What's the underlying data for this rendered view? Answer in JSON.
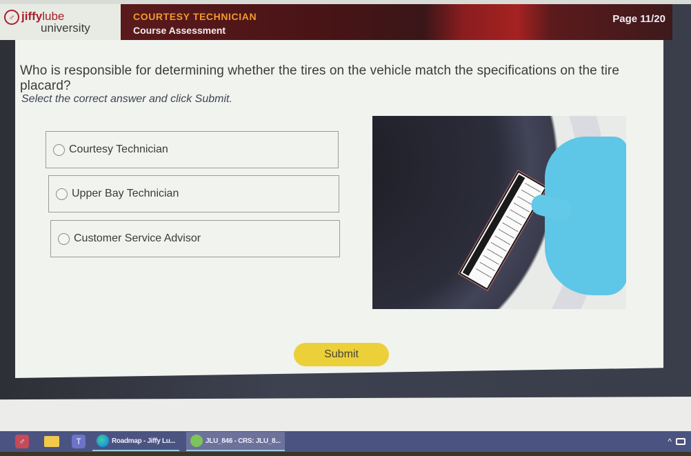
{
  "header": {
    "logo": {
      "icon": "jiffy-lube-logo-icon",
      "brand_bold": "jiffy",
      "brand_light": "lube",
      "sub": "university"
    },
    "course_name": "COURTESY TECHNICIAN",
    "course_subtitle": "Course Assessment",
    "page_indicator": "Page 11/20",
    "colors": {
      "banner": "#5a1a1c",
      "course_name": "#f39a2e",
      "brand": "#a71f2a"
    }
  },
  "question": {
    "text": "Who is responsible for determining whether the tires on the vehicle match the specifications on the tire placard?",
    "instruction": "Select the correct answer and click Submit.",
    "options": [
      {
        "label": "Courtesy Technician",
        "selected": false
      },
      {
        "label": "Upper Bay Technician",
        "selected": false
      },
      {
        "label": "Customer Service Advisor",
        "selected": false
      }
    ],
    "image_description": "Gloved hand pointing at tire information placard on vehicle door jamb"
  },
  "submit": {
    "label": "Submit",
    "color": "#ecd03a"
  },
  "taskbar": {
    "pinned": [
      {
        "icon": "jiffy-lube-app-icon"
      },
      {
        "icon": "file-explorer-icon"
      },
      {
        "icon": "teams-icon"
      }
    ],
    "apps": [
      {
        "icon": "edge-icon",
        "label": "Roadmap - Jiffy Lu..."
      },
      {
        "icon": "lms-icon",
        "label": "JLU_846 - CRS: JLU_8..."
      }
    ],
    "tray": {
      "chevron": "^",
      "icon": "network-icon"
    }
  }
}
